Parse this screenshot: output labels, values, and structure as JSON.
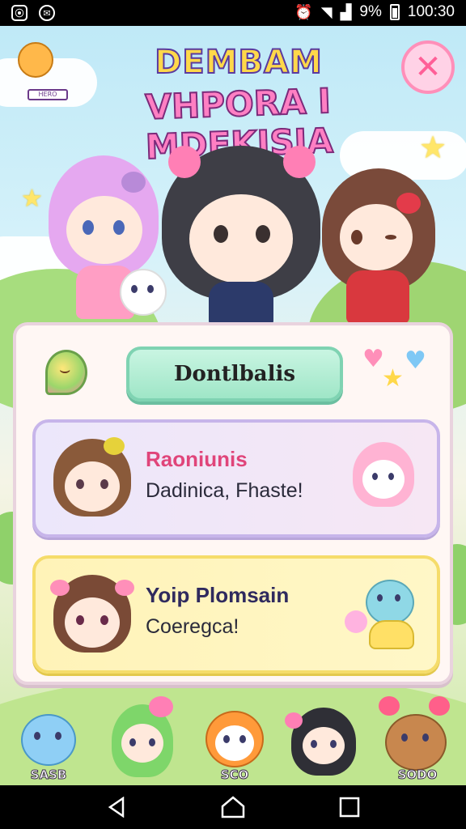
{
  "status_bar": {
    "left_icons": [
      "notification-icon",
      "message-icon"
    ],
    "battery_percent": "9%",
    "time": "100:30"
  },
  "game": {
    "title_line1": "DEMBAM",
    "title_line2": "VHPORA I MDEKISIA",
    "badge_label": "HERO"
  },
  "panel": {
    "tab_label": "Dontlbalis",
    "cards": [
      {
        "title": "Raoniunis",
        "subtitle": "Dadinica, Fhaste!"
      },
      {
        "title": "Yoip Plomsain",
        "subtitle": "Coeregca!"
      }
    ]
  },
  "bottom_characters": [
    {
      "label": "SASB"
    },
    {
      "label": ""
    },
    {
      "label": "SCO"
    },
    {
      "label": ""
    },
    {
      "label": "SODO"
    }
  ],
  "colors": {
    "accent_pink": "#ff7fb5",
    "accent_mint": "#9fe6c7",
    "card_lavender": "#ece7fb",
    "card_yellow": "#fff3b8"
  }
}
